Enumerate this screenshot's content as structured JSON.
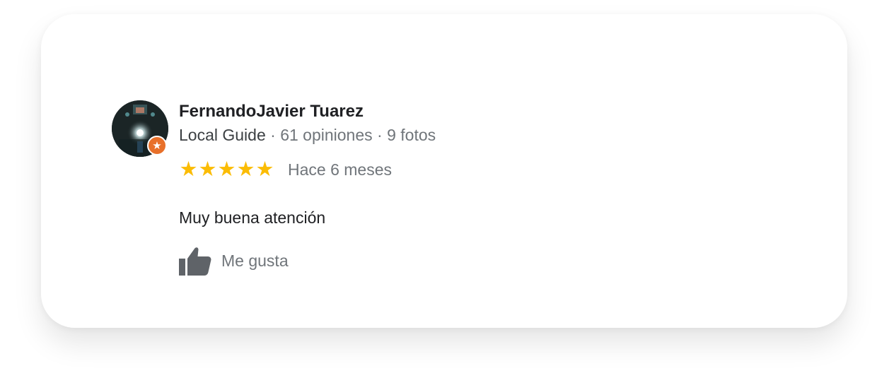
{
  "reviewer": {
    "name": "FernandoJavier Tuarez",
    "badge": "Local Guide",
    "separator_1": " · ",
    "reviews_count": "61 opiniones",
    "separator_2": " · ",
    "photos_count": "9 fotos",
    "avatar_icon": "profile-photo",
    "badge_icon": "local-guide-star-icon"
  },
  "review": {
    "rating": 5,
    "rating_max": 5,
    "star_glyph": "★",
    "time_ago": "Hace 6 meses",
    "text": "Muy buena atención"
  },
  "actions": {
    "like_label": "Me gusta",
    "like_icon": "thumbs-up-icon"
  },
  "colors": {
    "star": "#fbbc04",
    "badge": "#e8702a",
    "name": "#202124",
    "secondary": "#70757a",
    "like_icon": "#5f6368"
  }
}
